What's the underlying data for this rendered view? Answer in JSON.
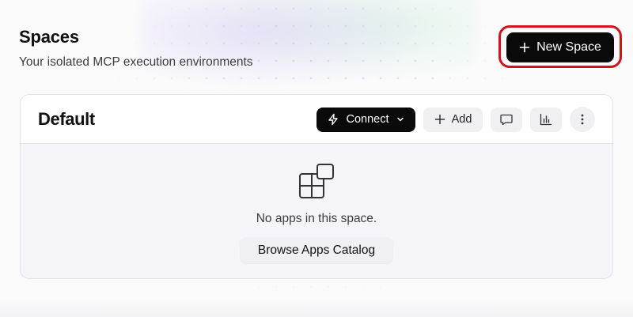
{
  "page": {
    "title": "Spaces",
    "subtitle": "Your isolated MCP execution environments",
    "new_space_label": "New Space"
  },
  "space": {
    "name": "Default",
    "connect_label": "Connect",
    "add_label": "Add",
    "empty_text": "No apps in this space.",
    "browse_label": "Browse Apps Catalog"
  },
  "icons": {
    "plus": "plus-icon",
    "bolt": "bolt-icon",
    "chevron": "chevron-down-icon",
    "comment": "comment-icon",
    "chart": "bar-chart-icon",
    "more": "more-vertical-icon",
    "apps": "apps-icon"
  },
  "colors": {
    "primary_button": "#0a0a0a",
    "highlight_ring": "#d3121b",
    "secondary_button": "#f0f0f2"
  }
}
